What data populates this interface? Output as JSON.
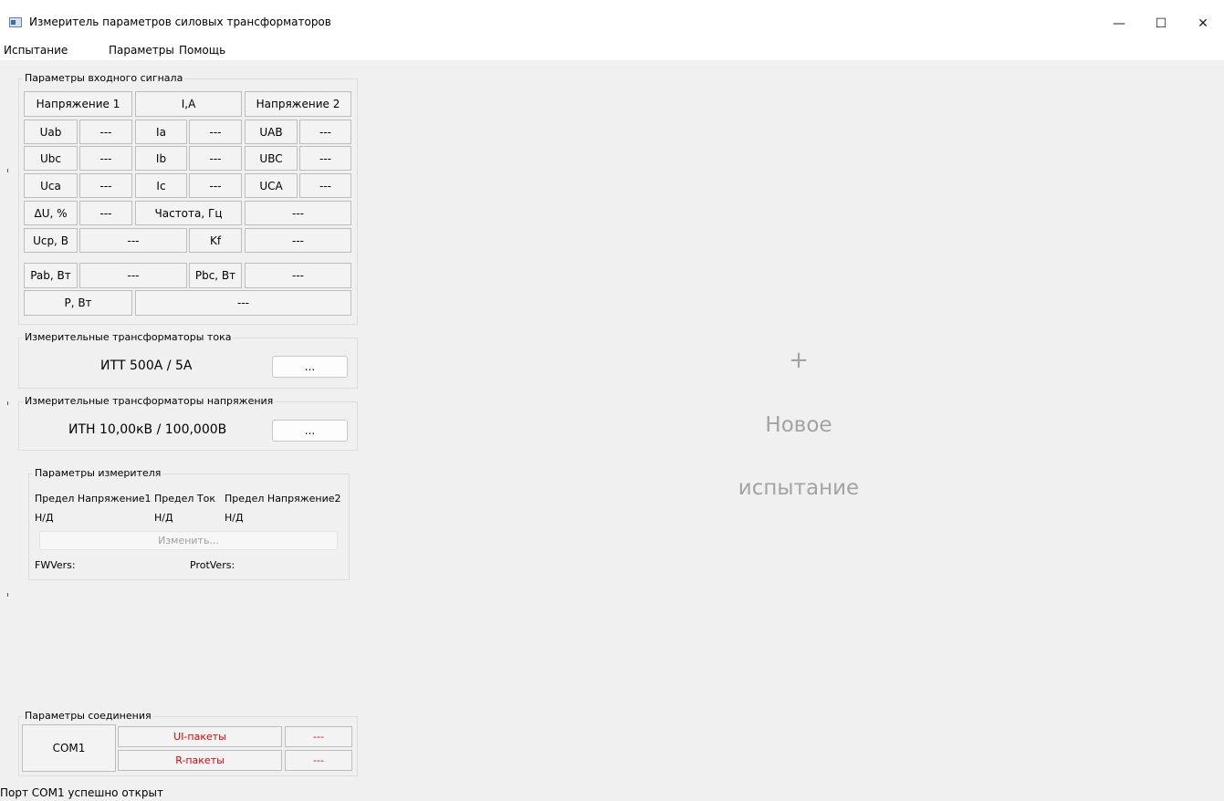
{
  "window": {
    "title": "Измеритель параметров силовых трансформаторов",
    "minimize": "—",
    "maximize": "☐",
    "close": "✕"
  },
  "menu": [
    "Испытание",
    "Параметры",
    "Помощь"
  ],
  "input_signal": {
    "title": "Параметры входного сигнала",
    "headers": [
      "Напряжение 1",
      "I,A",
      "Напряжение 2"
    ],
    "rows": [
      [
        "Uab",
        "---",
        "Ia",
        "---",
        "UAB",
        "---"
      ],
      [
        "Ubc",
        "---",
        "Ib",
        "---",
        "UBC",
        "---"
      ],
      [
        "Uca",
        "---",
        "Ic",
        "---",
        "UCA",
        "---"
      ]
    ],
    "du_label": "ΔU, %",
    "du_value": "---",
    "freq_label": "Частота, Гц",
    "freq_value": "---",
    "ucp_label": "Ucp, В",
    "ucp_value": "---",
    "kf_label": "Kf",
    "kf_value": "---",
    "pab_label": "Pab, Вт",
    "pab_value": "---",
    "pbc_label": "Pbc, Вт",
    "pbc_value": "---",
    "p_label": "P, Вт",
    "p_value": "---"
  },
  "current_transformers": {
    "title": "Измерительные трансформаторы тока",
    "value": "ИТТ 500А / 5А",
    "button": "..."
  },
  "voltage_transformers": {
    "title": "Измерительные трансформаторы напряжения",
    "value": "ИТН 10,00кВ / 100,000В",
    "button": "..."
  },
  "meter_params": {
    "title": "Параметры измерителя",
    "limit_u1_label": "Предел Напряжение1",
    "limit_i_label": "Предел Ток",
    "limit_u2_label": "Предел Напряжение2",
    "limit_u1_value": "Н/Д",
    "limit_i_value": "Н/Д",
    "limit_u2_value": "Н/Д",
    "change_button": "Изменить...",
    "fw_label": "FWVers:",
    "prot_label": "ProtVers:"
  },
  "connection": {
    "title": "Параметры соединения",
    "port": "COM1",
    "ui_packets_label": "UI-пакеты",
    "ui_packets_value": "---",
    "r_packets_label": "R-пакеты",
    "r_packets_value": "---"
  },
  "new_test": {
    "plus": "+",
    "line1": "Новое",
    "line2": "испытание"
  },
  "status": "Порт COM1 успешно открыт",
  "colors": {
    "accent_red": "#e00000",
    "placeholder": "#a3a3a3"
  }
}
